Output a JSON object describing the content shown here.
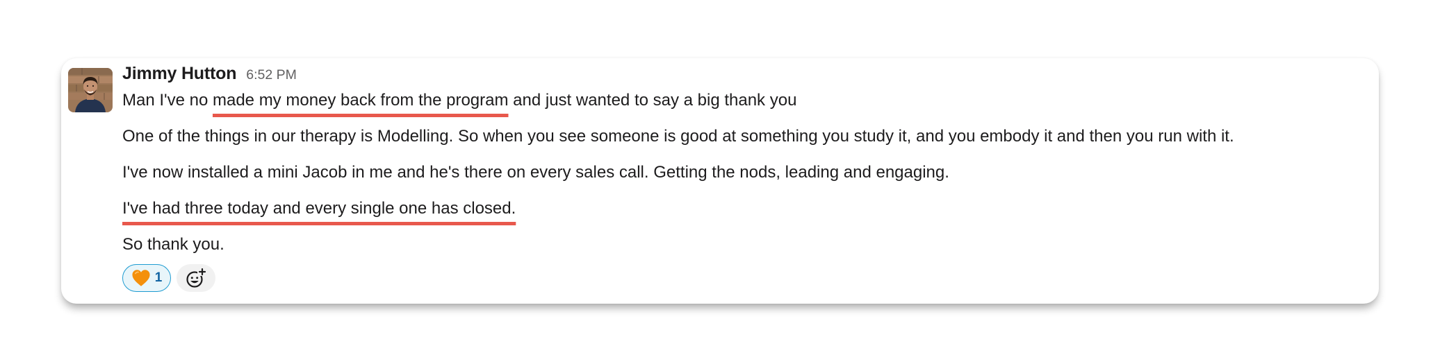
{
  "message": {
    "author": "Jimmy Hutton",
    "timestamp": "6:52 PM",
    "line1": {
      "before": "Man I've no ",
      "highlight": "made my money back from the program",
      "after": " and just wanted to say a big thank you"
    },
    "line2": "One of the things in our therapy is Modelling. So when you see someone is good at something you study it, and you embody it and then you run with it.",
    "line3": "I've now installed a mini Jacob in me and he's there on every sales call. Getting the nods, leading and engaging.",
    "line4": "I've had three today and every single one has closed.",
    "line5": "So thank you."
  },
  "reactions": [
    {
      "icon": "orange-heart-icon",
      "count": "1"
    }
  ],
  "add_reaction_icon": "add-emoji-icon",
  "colors": {
    "highlight_underline": "#e8584c",
    "reaction_border": "#1d9bd1",
    "reaction_bg": "#e8f5fa",
    "reaction_count": "#1264a3",
    "timestamp": "#616061",
    "heart": "#f4900c"
  }
}
